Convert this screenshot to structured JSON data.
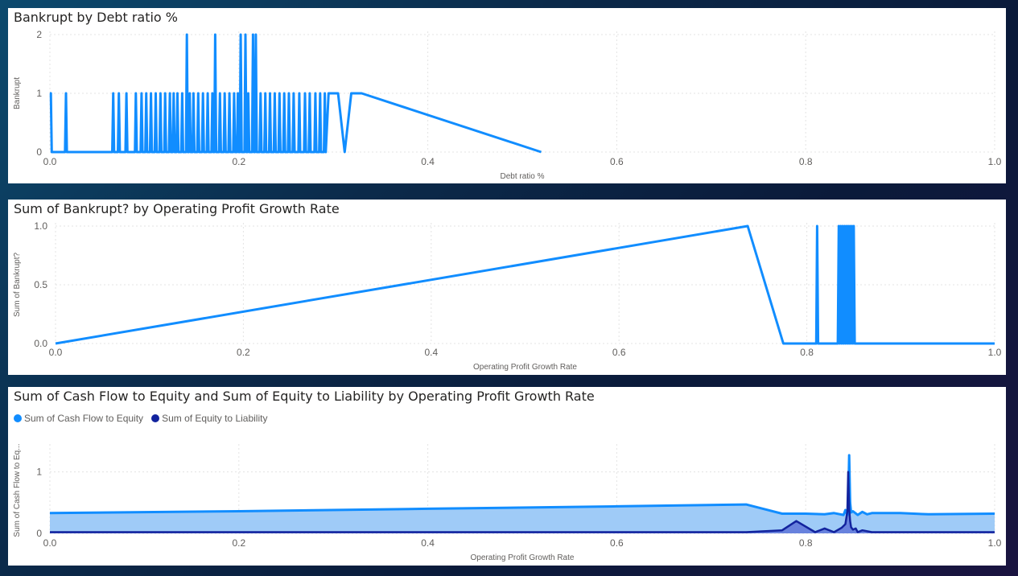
{
  "colors": {
    "light_blue": "#118DFF",
    "dark_blue": "#12239E",
    "area_light": "#9FCBF7",
    "grid": "#dcdcdc"
  },
  "charts": [
    {
      "title": "Bankrupt by Debt ratio %",
      "xlabel": "Debt ratio %",
      "ylabel": "Bankrupt",
      "x_ticks": [
        "0.0",
        "0.2",
        "0.4",
        "0.6",
        "0.8",
        "1.0"
      ],
      "y_ticks": [
        "0",
        "1",
        "2"
      ]
    },
    {
      "title": "Sum of Bankrupt? by Operating Profit Growth Rate",
      "xlabel": "Operating Profit Growth Rate",
      "ylabel": "Sum of Bankrupt?",
      "x_ticks": [
        "0.0",
        "0.2",
        "0.4",
        "0.6",
        "0.8",
        "1.0"
      ],
      "y_ticks": [
        "0.0",
        "0.5",
        "1.0"
      ]
    },
    {
      "title": "Sum of Cash Flow to Equity and Sum of Equity to Liability by Operating Profit Growth Rate",
      "xlabel": "Operating Profit Growth Rate",
      "ylabel": "Sum of Cash Flow to Eq...",
      "x_ticks": [
        "0.0",
        "0.2",
        "0.4",
        "0.6",
        "0.8",
        "1.0"
      ],
      "y_ticks": [
        "0",
        "1"
      ],
      "legend": [
        "Sum of  Cash Flow to Equity",
        "Sum of  Equity to Liability"
      ]
    }
  ],
  "chart_data": [
    {
      "type": "line",
      "title": "Bankrupt by Debt ratio %",
      "xlabel": "Debt ratio %",
      "ylabel": "Bankrupt",
      "xlim": [
        0,
        1
      ],
      "ylim": [
        0,
        2
      ],
      "x": [
        0.0,
        0.001,
        0.002,
        0.003,
        0.016,
        0.017,
        0.018,
        0.066,
        0.067,
        0.068,
        0.072,
        0.073,
        0.074,
        0.08,
        0.081,
        0.082,
        0.09,
        0.091,
        0.092,
        0.096,
        0.097,
        0.098,
        0.101,
        0.102,
        0.103,
        0.106,
        0.107,
        0.108,
        0.111,
        0.112,
        0.113,
        0.116,
        0.117,
        0.118,
        0.121,
        0.122,
        0.123,
        0.126,
        0.127,
        0.128,
        0.13,
        0.131,
        0.132,
        0.134,
        0.135,
        0.136,
        0.139,
        0.14,
        0.141,
        0.144,
        0.145,
        0.146,
        0.147,
        0.148,
        0.149,
        0.151,
        0.152,
        0.153,
        0.156,
        0.157,
        0.158,
        0.161,
        0.162,
        0.163,
        0.166,
        0.167,
        0.168,
        0.171,
        0.172,
        0.173,
        0.174,
        0.175,
        0.176,
        0.179,
        0.18,
        0.181,
        0.184,
        0.185,
        0.186,
        0.189,
        0.19,
        0.191,
        0.194,
        0.195,
        0.196,
        0.198,
        0.199,
        0.2,
        0.201,
        0.202,
        0.203,
        0.206,
        0.207,
        0.208,
        0.209,
        0.21,
        0.211,
        0.214,
        0.215,
        0.216,
        0.217,
        0.218,
        0.219,
        0.222,
        0.223,
        0.224,
        0.227,
        0.228,
        0.229,
        0.232,
        0.233,
        0.234,
        0.237,
        0.238,
        0.239,
        0.242,
        0.243,
        0.244,
        0.247,
        0.248,
        0.249,
        0.252,
        0.253,
        0.254,
        0.257,
        0.258,
        0.259,
        0.263,
        0.264,
        0.265,
        0.269,
        0.27,
        0.271,
        0.274,
        0.275,
        0.276,
        0.28,
        0.281,
        0.282,
        0.285,
        0.286,
        0.287,
        0.29,
        0.291,
        0.292,
        0.295,
        0.296,
        0.305,
        0.312,
        0.319,
        0.322,
        0.33,
        0.52,
        1.0
      ],
      "y": [
        1,
        1,
        0,
        0,
        0,
        1,
        0,
        0,
        1,
        0,
        0,
        1,
        0,
        0,
        1,
        0,
        0,
        1,
        0,
        0,
        1,
        0,
        0,
        1,
        0,
        0,
        1,
        0,
        0,
        1,
        0,
        0,
        1,
        0,
        0,
        1,
        0,
        0,
        1,
        0,
        0,
        1,
        0,
        0,
        1,
        0,
        0,
        1,
        0,
        0,
        2,
        0,
        0,
        1,
        0,
        0,
        1,
        0,
        0,
        1,
        0,
        0,
        1,
        0,
        0,
        1,
        0,
        0,
        1,
        0,
        0,
        2,
        0,
        0,
        1,
        0,
        0,
        1,
        0,
        0,
        1,
        0,
        0,
        1,
        0,
        0,
        1,
        0,
        0,
        2,
        0,
        0,
        2,
        0,
        0,
        1,
        0,
        0,
        2,
        0,
        0,
        2,
        0,
        0,
        1,
        0,
        0,
        1,
        0,
        0,
        1,
        0,
        0,
        1,
        0,
        0,
        1,
        0,
        0,
        1,
        0,
        0,
        1,
        0,
        0,
        1,
        0,
        0,
        1,
        0,
        0,
        1,
        0,
        0,
        1,
        0,
        0,
        1,
        0,
        0,
        1,
        0,
        0,
        1,
        0,
        1,
        1,
        1,
        0,
        1,
        1,
        1,
        0
      ]
    },
    {
      "type": "line",
      "title": "Sum of Bankrupt? by Operating Profit Growth Rate",
      "xlabel": "Operating Profit Growth Rate",
      "ylabel": "Sum of Bankrupt?",
      "xlim": [
        0,
        1
      ],
      "ylim": [
        0,
        1
      ],
      "x": [
        0.0,
        0.737,
        0.775,
        0.81,
        0.811,
        0.812,
        0.833,
        0.834,
        0.835,
        0.836,
        0.837,
        0.838,
        0.839,
        0.84,
        0.841,
        0.842,
        0.843,
        0.844,
        0.845,
        0.846,
        0.847,
        0.848,
        0.849,
        0.85,
        0.851,
        0.852,
        1.0
      ],
      "y": [
        0,
        1,
        0,
        0,
        1,
        0,
        0,
        1,
        0,
        1,
        0,
        1,
        0,
        1,
        0,
        1,
        0,
        1,
        0,
        1,
        0,
        1,
        0,
        1,
        0,
        0,
        0
      ]
    },
    {
      "type": "area",
      "title": "Sum of Cash Flow to Equity and Sum of Equity to Liability by Operating Profit Growth Rate",
      "xlabel": "Operating Profit Growth Rate",
      "ylabel": "Sum of Cash Flow to Eq...",
      "xlim": [
        0,
        1
      ],
      "ylim": [
        0,
        1.4
      ],
      "series": [
        {
          "name": "Sum of  Cash Flow to Equity",
          "x": [
            0.0,
            0.2,
            0.4,
            0.6,
            0.737,
            0.775,
            0.8,
            0.82,
            0.83,
            0.84,
            0.842,
            0.844,
            0.845,
            0.846,
            0.847,
            0.848,
            0.85,
            0.855,
            0.86,
            0.865,
            0.87,
            0.9,
            0.93,
            1.0
          ],
          "y": [
            0.33,
            0.36,
            0.4,
            0.44,
            0.47,
            0.32,
            0.32,
            0.31,
            0.33,
            0.3,
            0.38,
            0.3,
            0.5,
            1.27,
            0.5,
            0.34,
            0.36,
            0.3,
            0.35,
            0.31,
            0.33,
            0.33,
            0.31,
            0.32
          ]
        },
        {
          "name": "Sum of  Equity to Liability",
          "x": [
            0.0,
            0.737,
            0.775,
            0.79,
            0.81,
            0.82,
            0.83,
            0.838,
            0.842,
            0.844,
            0.845,
            0.846,
            0.847,
            0.848,
            0.85,
            0.853,
            0.855,
            0.86,
            0.87,
            0.9,
            1.0
          ],
          "y": [
            0.02,
            0.02,
            0.05,
            0.2,
            0.02,
            0.08,
            0.02,
            0.09,
            0.15,
            0.35,
            1.0,
            0.4,
            0.2,
            0.1,
            0.06,
            0.08,
            0.02,
            0.05,
            0.02,
            0.02,
            0.02
          ]
        }
      ]
    }
  ]
}
